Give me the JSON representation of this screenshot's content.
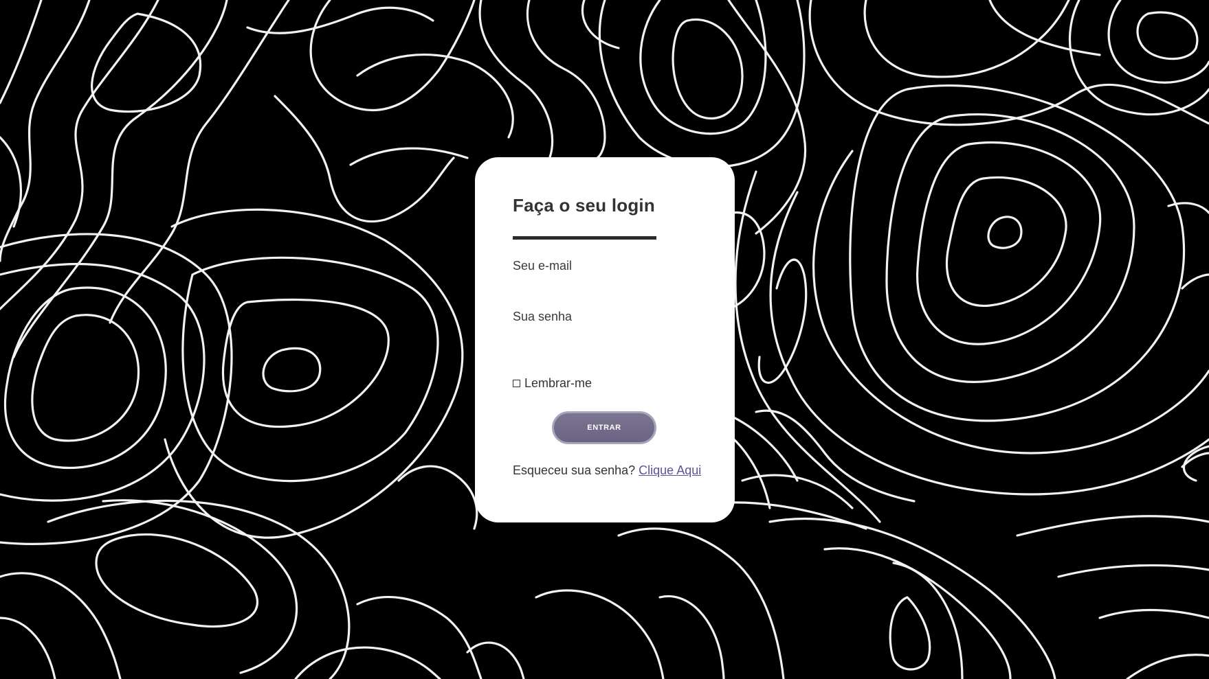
{
  "login": {
    "title": "Faça o seu login",
    "email_label": "Seu e-mail",
    "email_value": "",
    "password_label": "Sua senha",
    "password_value": "",
    "remember_label": "Lembrar-me",
    "remember_checked": false,
    "submit_label": "ENTRAR",
    "forgot_text": "Esqueceu sua senha?",
    "forgot_link_label": "Clique Aqui"
  },
  "colors": {
    "background": "#000000",
    "contour_lines": "#f2f2f2",
    "card": "#ffffff",
    "button": "#6f6988",
    "link": "#5c5496"
  },
  "icons": {
    "checkbox": "empty-checkbox-icon"
  }
}
